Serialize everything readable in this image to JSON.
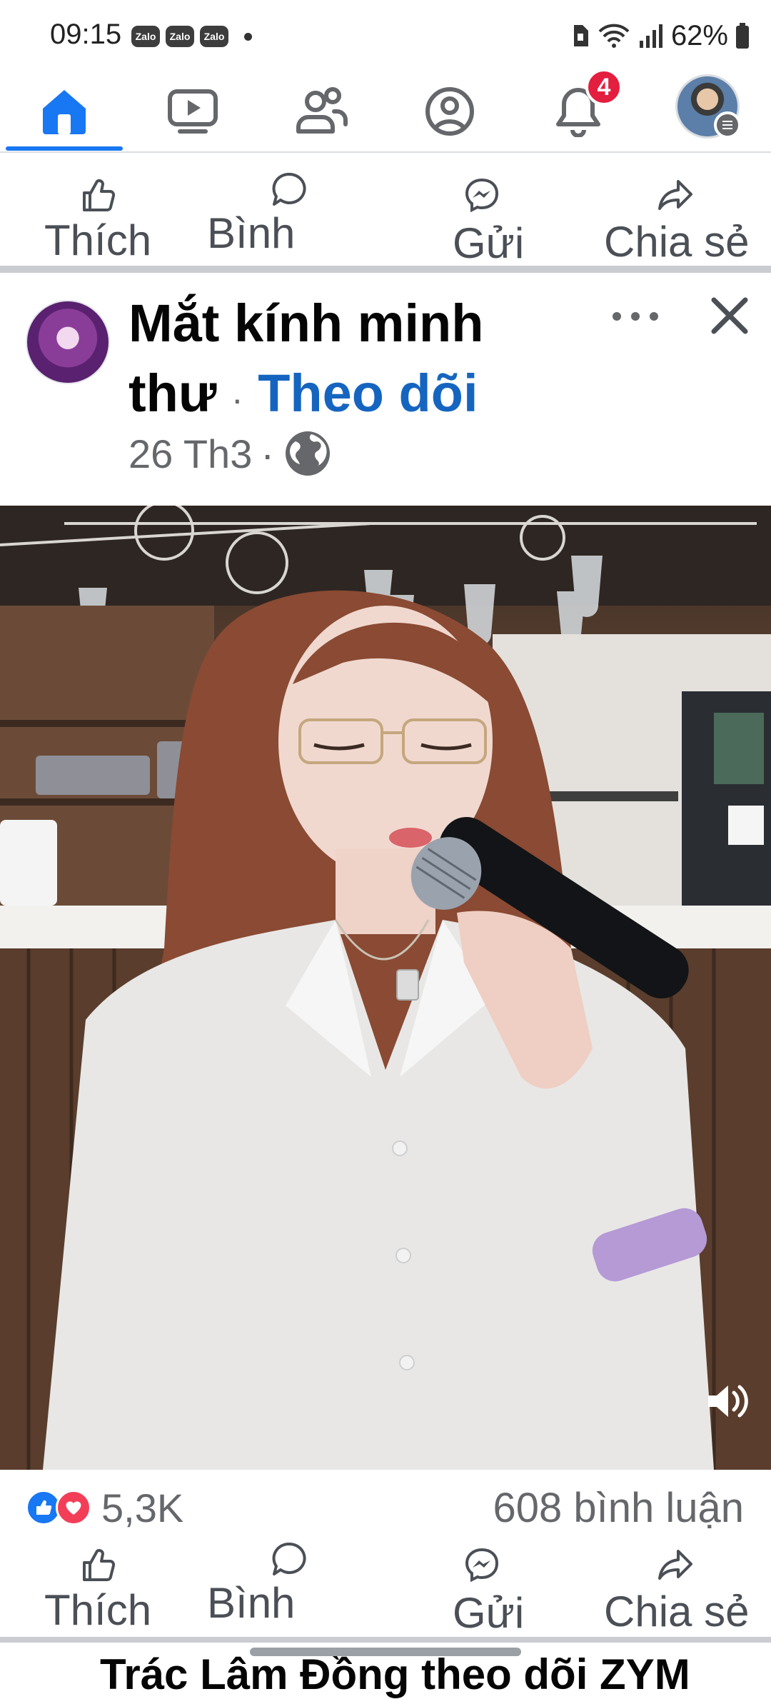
{
  "status_bar": {
    "time": "09:15",
    "notification_apps": [
      "Zalo",
      "Zalo",
      "Zalo"
    ],
    "battery": "62%"
  },
  "nav": {
    "tabs": [
      "home-icon",
      "video-icon",
      "friends-icon",
      "profile-icon",
      "notifications-icon",
      "menu-avatar"
    ],
    "notification_count": "4",
    "accent_color": "#1877f2"
  },
  "top_actions": {
    "like": "Thích",
    "comment": "Bình",
    "send": "Gửi",
    "share": "Chia sẻ"
  },
  "post": {
    "page_name_line1": "Mắt kính minh",
    "page_name_line2": "thư",
    "separator": "·",
    "follow_label": "Theo dõi",
    "date": "26 Th3",
    "date_separator": "·",
    "audience_icon": "globe-icon",
    "reaction_count": "5,3K",
    "comment_count": "608 bình luận"
  },
  "bottom_actions": {
    "like": "Thích",
    "comment": "Bình",
    "send": "Gửi",
    "share": "Chia sẻ"
  },
  "next_post_preview": "Trác Lâm Đồng theo dõi ZYM"
}
